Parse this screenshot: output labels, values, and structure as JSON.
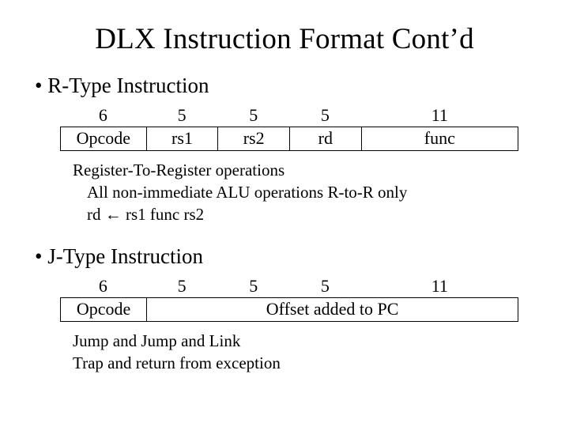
{
  "title": "DLX Instruction Format Cont’d",
  "rtype": {
    "heading": "• R-Type Instruction",
    "bits": {
      "opcode": "6",
      "rs1": "5",
      "rs2": "5",
      "rd": "5",
      "func": "11"
    },
    "fields": {
      "opcode": "Opcode",
      "rs1": "rs1",
      "rs2": "rs2",
      "rd": "rd",
      "func": "func"
    },
    "desc_line1": "Register-To-Register operations",
    "desc_line2": "All non-immediate ALU operations R-to-R only",
    "desc_line3_pre": "rd ",
    "desc_line3_arrow": "←",
    "desc_line3_post": " rs1 func rs2"
  },
  "jtype": {
    "heading": "• J-Type Instruction",
    "bits": {
      "opcode": "6",
      "c2": "5",
      "c3": "5",
      "c4": "5",
      "c5": "11"
    },
    "fields": {
      "opcode": "Opcode",
      "offset": "Offset added to PC",
      "func": ""
    },
    "desc_line1": "Jump and Jump and Link",
    "desc_line2": "Trap and return from exception"
  }
}
